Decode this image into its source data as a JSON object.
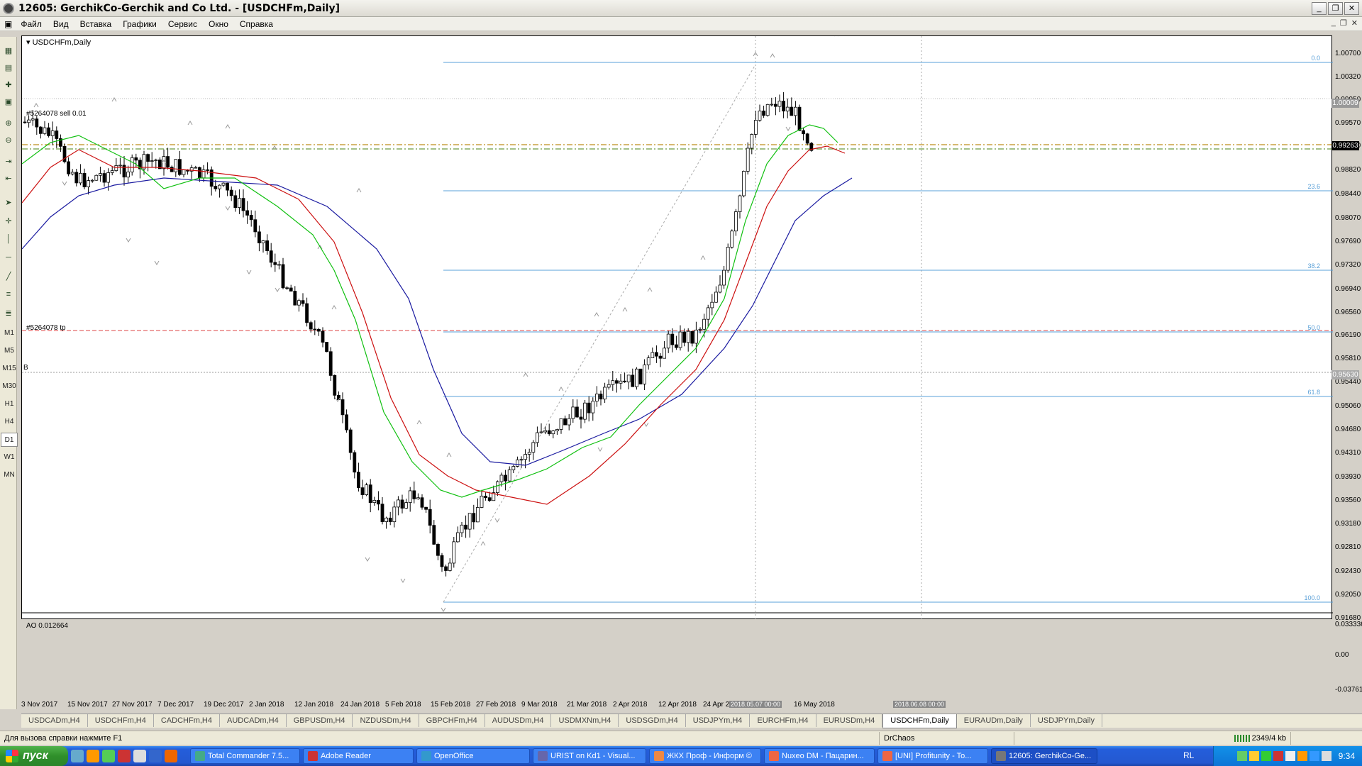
{
  "window": {
    "title": "12605: GerchikCo-Gerchik and Co Ltd. - [USDCHFm,Daily]",
    "minimize": "_",
    "restore": "❐",
    "close": "✕"
  },
  "menu": [
    "Файл",
    "Вид",
    "Вставка",
    "Графики",
    "Сервис",
    "Окно",
    "Справка"
  ],
  "left_toolbar": {
    "timeframes": [
      "M1",
      "M5",
      "M15",
      "M30",
      "H1",
      "H4",
      "D1",
      "W1",
      "MN"
    ],
    "active_timeframe": "D1"
  },
  "chart": {
    "symbol_label": "USDCHFm,Daily",
    "order_label_sell": "#5264078 sell 0.01",
    "order_label_tp": "#5264078 tp",
    "order_label_b": "B",
    "fibo_levels": [
      "0.0",
      "23.6",
      "38.2",
      "50.0",
      "61.8",
      "100.0"
    ],
    "price_axis": [
      "1.00700",
      "1.00320",
      "0.99950",
      "0.99570",
      "0.99263",
      "0.99190",
      "0.98820",
      "0.98440",
      "0.98070",
      "0.97690",
      "0.97320",
      "0.96940",
      "0.96560",
      "0.96190",
      "0.95810",
      "0.95440",
      "0.95060",
      "0.94680",
      "0.94310",
      "0.93930",
      "0.93560",
      "0.93180",
      "0.92810",
      "0.92430",
      "0.92050",
      "0.91680"
    ],
    "price_badge_current": "0.99263",
    "price_badge_top": "1.00009",
    "price_badge_mid": "0.95630",
    "date_axis": [
      "3 Nov 2017",
      "15 Nov 2017",
      "27 Nov 2017",
      "7 Dec 2017",
      "19 Dec 2017",
      "2 Jan 2018",
      "12 Jan 2018",
      "24 Jan 2018",
      "5 Feb 2018",
      "15 Feb 2018",
      "27 Feb 2018",
      "9 Mar 2018",
      "21 Mar 2018",
      "2 Apr 2018",
      "12 Apr 2018",
      "24 Apr 2018",
      "16 May 2018"
    ],
    "date_badge_1": "2018.05.07 00:00",
    "date_badge_2": "2018.06.08 00:00",
    "ao_label": "AO 0.012664",
    "ao_axis": [
      "0.033336",
      "0.00",
      "-0.037619"
    ]
  },
  "tabs": [
    "USDCADm,H4",
    "USDCHFm,H4",
    "CADCHFm,H4",
    "AUDCADm,H4",
    "GBPUSDm,H4",
    "NZDUSDm,H4",
    "GBPCHFm,H4",
    "AUDUSDm,H4",
    "USDMXNm,H4",
    "USDSGDm,H4",
    "USDJPYm,H4",
    "EURCHFm,H4",
    "EURUSDm,H4",
    "USDCHFm,Daily",
    "EURAUDm,Daily",
    "USDJPYm,Daily"
  ],
  "active_tab": "USDCHFm,Daily",
  "status": {
    "help": "Для вызова справки нажмите F1",
    "profile": "DrChaos",
    "traffic": "2349/4 kb"
  },
  "taskbar": {
    "start": "пуск",
    "tasks": [
      "Total Commander 7.5...",
      "Adobe Reader",
      "OpenOffice",
      "URIST on Kd1 - Visual...",
      "ЖКХ Проф - Информ ©",
      "Nuxeo DM - Пацарин...",
      "[UNI] Profitunity - To...",
      "12605: GerchikCo-Ge..."
    ],
    "active_task": "12605: GerchikCo-Ge...",
    "lang": "RL",
    "time": "9:34"
  },
  "colors": {
    "bull_bar": "#0000cc",
    "bear_bar": "#dd0000",
    "alligator_jaw": "#1a1aa0",
    "alligator_teeth": "#cc1010",
    "alligator_lips": "#10c010",
    "fibo": "#5aa0d8"
  }
}
